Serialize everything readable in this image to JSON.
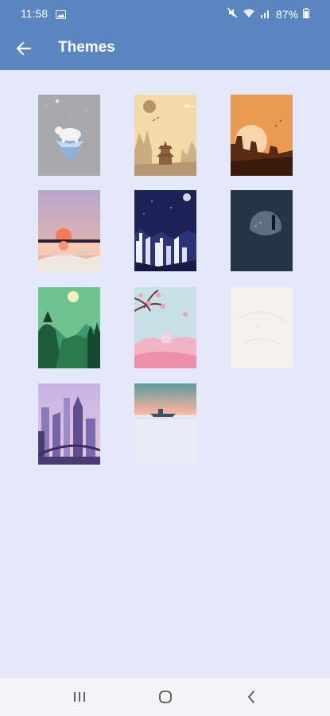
{
  "status": {
    "time": "11:58",
    "battery": "87%"
  },
  "appbar": {
    "title": "Themes"
  },
  "themes": [
    {
      "name": "Polar bear"
    },
    {
      "name": "Pagoda"
    },
    {
      "name": "Desert sunset"
    },
    {
      "name": "Lake sunset"
    },
    {
      "name": "Night city"
    },
    {
      "name": "Lighthouse"
    },
    {
      "name": "Green forest"
    },
    {
      "name": "Cherry blossom"
    },
    {
      "name": "White"
    },
    {
      "name": "Purple city"
    },
    {
      "name": "Sea ship"
    }
  ],
  "colors": {
    "appbar": "#5b85c1",
    "background": "#e3e9f9",
    "navbar": "#f4f4f6"
  }
}
